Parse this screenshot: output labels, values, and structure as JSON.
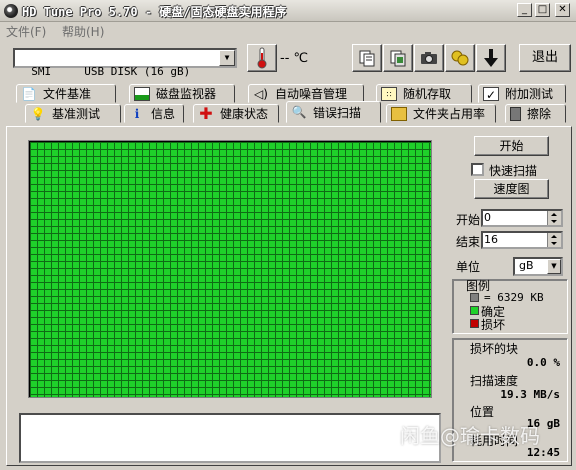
{
  "window": {
    "title": "HD Tune Pro 5.70 - 硬盘/固态硬盘实用程序",
    "minimize": "_",
    "maximize": "□",
    "close": "✕"
  },
  "menu": {
    "file": "文件(F)",
    "help": "帮助(H)"
  },
  "toolbar": {
    "drive": "SMI     USB DISK (16 gB)",
    "temperature": "-- ℃",
    "exit": "退出",
    "icons": [
      "thermometer-icon",
      "copy-info-icon",
      "copy-screen-icon",
      "camera-icon",
      "health-icon",
      "download-icon"
    ]
  },
  "tabs_row1": [
    {
      "label": "文件基准",
      "icon": "file-benchmark-icon"
    },
    {
      "label": "磁盘监视器",
      "icon": "disk-monitor-icon"
    },
    {
      "label": "自动噪音管理",
      "icon": "speaker-icon"
    },
    {
      "label": "随机存取",
      "icon": "random-access-icon"
    },
    {
      "label": "附加测试",
      "icon": "extra-tests-icon"
    }
  ],
  "tabs_row2": [
    {
      "label": "基准测试",
      "icon": "bulb-icon"
    },
    {
      "label": "信息",
      "icon": "info-icon"
    },
    {
      "label": "健康状态",
      "icon": "health-cross-icon"
    },
    {
      "label": "错误扫描",
      "icon": "magnifier-icon",
      "active": true
    },
    {
      "label": "文件夹占用率",
      "icon": "folder-icon"
    },
    {
      "label": "擦除",
      "icon": "trash-icon"
    }
  ],
  "scan": {
    "start_button": "开始",
    "quick_scan_label": "快速扫描",
    "quick_scan_checked": false,
    "speed_map_button": "速度图",
    "start_label": "开始",
    "start_value": "0",
    "end_label": "结束",
    "end_value": "16",
    "unit_label": "单位",
    "unit_value": "gB",
    "grid_color": "#1fd02a"
  },
  "legend": {
    "title": "图例",
    "block_size": "= 6329 KB",
    "ok_label": "确定",
    "bad_label": "损坏",
    "colors": {
      "block": "#808080",
      "ok": "#1fd02a",
      "bad": "#c00000"
    }
  },
  "stats": {
    "damaged_label": "损坏的块",
    "damaged_value": "0.0 %",
    "speed_label": "扫描速度",
    "speed_value": "19.3 MB/s",
    "position_label": "位置",
    "position_value": "16 gB",
    "elapsed_label": "耗用时间",
    "elapsed_value": "12:45"
  },
  "watermark": "闲鱼@瑜卡数码"
}
